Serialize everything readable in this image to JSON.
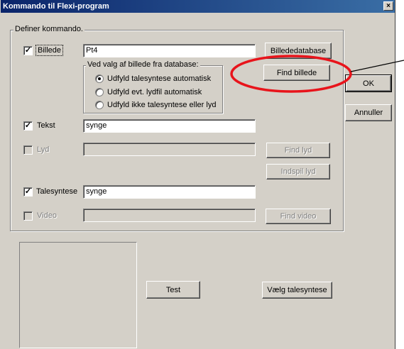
{
  "window": {
    "title": "Kommando til Flexi-program",
    "close_glyph": "×"
  },
  "group": {
    "label": "Definer kommando."
  },
  "billede": {
    "label": "Billede",
    "checked": true,
    "value": "Pt4"
  },
  "buttons": {
    "billededatabase": "Billededatabase",
    "find_billede": "Find billede",
    "ok": "OK",
    "annuller": "Annuller",
    "find_lyd": "Find lyd",
    "indspil_lyd": "Indspil lyd",
    "find_video": "Find video",
    "test": "Test",
    "vaelg_talesyntese": "Vælg talesyntese"
  },
  "options_group": {
    "label": "Ved valg af billede fra database:",
    "options": [
      {
        "label": "Udfyld talesyntese automatisk",
        "selected": true
      },
      {
        "label": "Udfyld evt. lydfil automatisk",
        "selected": false
      },
      {
        "label": "Udfyld ikke talesyntese eller lyd",
        "selected": false
      }
    ]
  },
  "tekst": {
    "label": "Tekst",
    "checked": true,
    "value": "synge"
  },
  "lyd": {
    "label": "Lyd",
    "checked": false,
    "value": ""
  },
  "talesyntese": {
    "label": "Talesyntese",
    "checked": true,
    "value": "synge"
  },
  "video": {
    "label": "Video",
    "checked": false,
    "value": ""
  },
  "glyphs": {
    "check": "✓"
  },
  "colors": {
    "annotation": "#e8141b",
    "face": "#d4d0c8"
  }
}
